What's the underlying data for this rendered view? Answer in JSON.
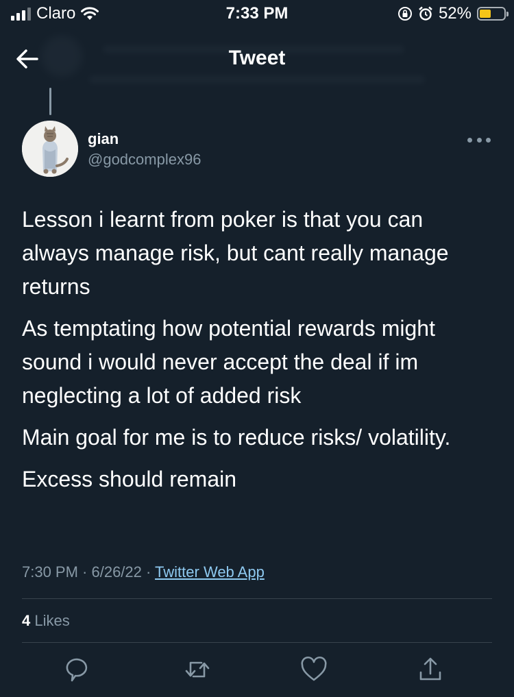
{
  "status_bar": {
    "carrier": "Claro",
    "time": "7:33 PM",
    "battery_percent": "52%",
    "battery_level": 0.52,
    "icons": [
      "signal-icon",
      "wifi-icon",
      "orientation-lock-icon",
      "alarm-icon",
      "battery-icon"
    ]
  },
  "nav": {
    "title": "Tweet",
    "back_icon": "back-arrow-icon"
  },
  "tweet": {
    "author": {
      "name": "gian",
      "handle": "@godcomplex96",
      "avatar_icon": "cat-avatar"
    },
    "paragraphs": [
      "Lesson i learnt from poker is that you can always manage risk, but cant really manage returns",
      "As temptating how potential rewards might sound i would never accept the deal if im neglecting a lot of added risk",
      "Main goal for me is to reduce risks/ volatility.",
      "Excess should remain"
    ],
    "timestamp": "7:30 PM · 6/26/22 · ",
    "source_app": "Twitter Web App",
    "likes_count": "4",
    "likes_label": " Likes"
  },
  "actions": [
    "reply-icon",
    "retweet-icon",
    "like-icon",
    "share-icon"
  ],
  "colors": {
    "background": "#15202b",
    "secondary_text": "#8899a6",
    "link": "#8ec9f0",
    "divider": "#38444d",
    "battery": "#f5c518"
  }
}
